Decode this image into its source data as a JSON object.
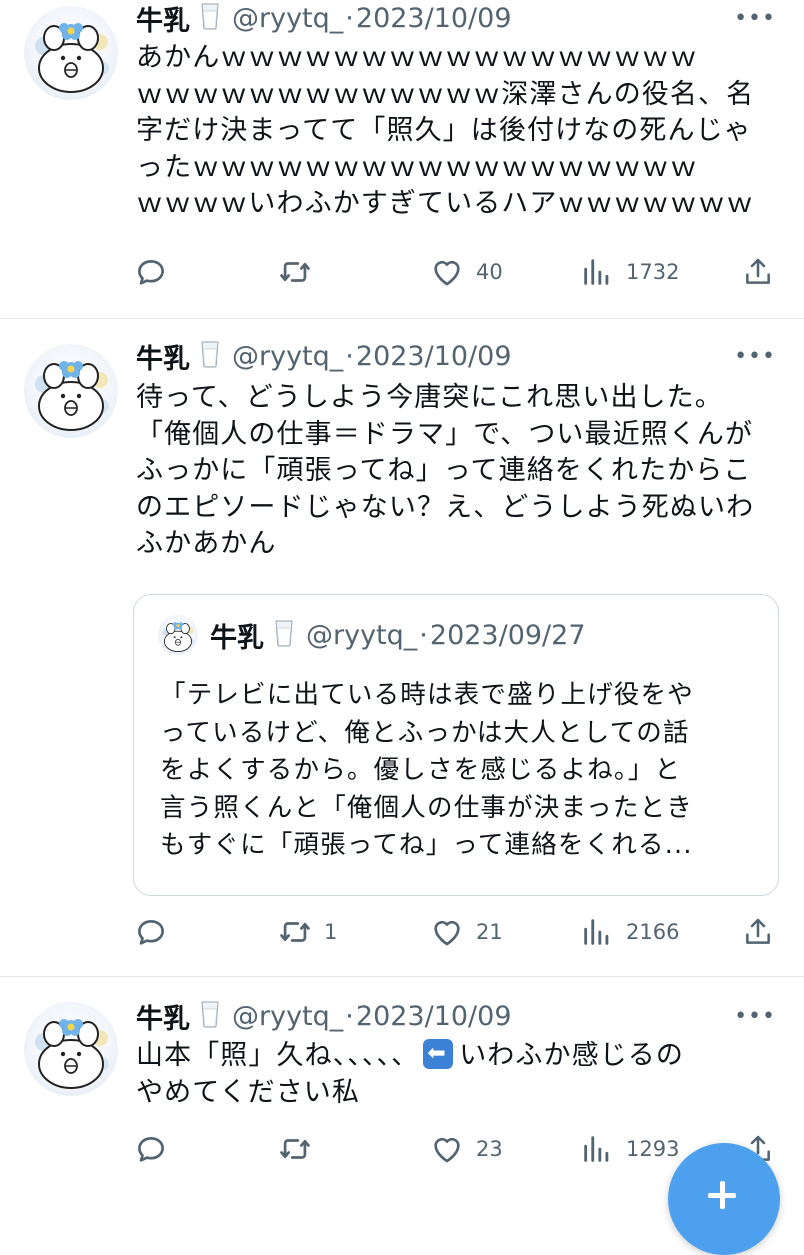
{
  "tweets": [
    {
      "name": "牛乳",
      "handle": "@ryytq_",
      "dot": "·",
      "date": "2023/10/09",
      "lines": [
        "あかんｗｗｗｗｗｗｗｗｗｗｗｗｗｗｗｗｗ",
        "ｗｗｗｗｗｗｗｗｗｗｗｗｗ深澤さんの役名、名",
        "字だけ決まってて「照久」は後付けなの死んじゃ",
        "ったｗｗｗｗｗｗｗｗｗｗｗｗｗｗｗｗｗｗ",
        "ｗｗｗｗいわふかすぎているハアｗｗｗｗｗｗｗ"
      ],
      "stats": {
        "replies": "",
        "retweets": "",
        "likes": "40",
        "views": "1732"
      }
    },
    {
      "name": "牛乳",
      "handle": "@ryytq_",
      "dot": "·",
      "date": "2023/10/09",
      "lines": [
        "待って、どうしよう今唐突にこれ思い出した。",
        "「俺個人の仕事＝ドラマ」で、つい最近照くんが",
        "ふっかに「頑張ってね」って連絡をくれたからこ",
        "のエピソードじゃない？え、どうしよう死ぬいわ",
        "ふかあかん"
      ],
      "quote": {
        "name": "牛乳",
        "handle": "@ryytq_",
        "dot": "·",
        "date": "2023/09/27",
        "lines": [
          "「テレビに出ている時は表で盛り上げ役をや",
          "っているけど、俺とふっかは大人としての話",
          "をよくするから。優しさを感じるよね。」と",
          "言う照くんと「俺個人の仕事が決まったとき",
          "もすぐに「頑張ってね」って連絡をくれる..."
        ]
      },
      "stats": {
        "replies": "",
        "retweets": "1",
        "likes": "21",
        "views": "2166"
      }
    },
    {
      "name": "牛乳",
      "handle": "@ryytq_",
      "dot": "·",
      "date": "2023/10/09",
      "line1_a": "山本「照」久ね、、、、、",
      "line1_emoji": "left-arrow-emoji",
      "line1_b": "いわふか感じるの",
      "line2": "やめてください私",
      "stats": {
        "replies": "",
        "retweets": "",
        "likes": "23",
        "views": "1293"
      }
    }
  ],
  "icons": {
    "reply": "reply-icon",
    "retweet": "retweet-icon",
    "like": "heart-icon",
    "views": "views-icon",
    "share": "share-icon",
    "more": "more-icon",
    "milk": "milk-glass-icon",
    "compose": "compose-plus-icon"
  },
  "colors": {
    "text": "#0f1419",
    "secondary": "#536471",
    "divider": "#e6e9ec",
    "accent": "#4da0ee"
  }
}
